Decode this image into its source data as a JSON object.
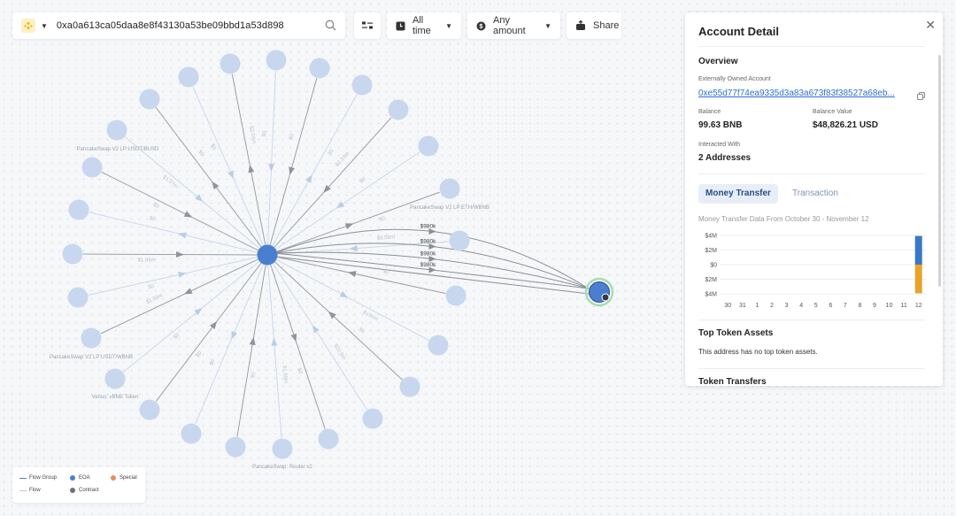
{
  "search": {
    "chain_icon": "bnb-chain-icon",
    "address": "0xa0a613ca05daa8e8f43130a53be09bbd1a53d898"
  },
  "toolbar": {
    "time_label": "All time",
    "amount_label": "Any amount",
    "share_label": "Share"
  },
  "graph": {
    "node_labels": {
      "lp_usdt_busd": "PancakeSwap V2 LP:USDT/BUSD",
      "lp_eth_wbnb": "PancakeSwap V2 LP:ETH/WBNB",
      "lp_usdt_wbnb": "PancakeSwap V2 LP:USDT/WBNB",
      "venus": "Venus: vBNB Token",
      "router": "PancakeSwap: Router v2"
    },
    "edge_labels": [
      "$980k",
      "$980k",
      "$980k",
      "$980k"
    ],
    "faint_edge_labels": [
      "$2.54m",
      "$0",
      "$0",
      "$0",
      "$2.33m",
      "$0",
      "$0",
      "$9.58m",
      "$0",
      "$136m",
      "$0",
      "$22.9m",
      "$0",
      "$1.60m",
      "$0",
      "$0",
      "$0",
      "$0",
      "$1.50m",
      "$0",
      "$1.06m",
      "$0",
      "$0",
      "$1.07m",
      "$0",
      "$0",
      "$0"
    ]
  },
  "legend": {
    "flow_group": "Flow Group",
    "eoa": "EOA",
    "special": "Special",
    "flow": "Flow",
    "contract": "Contract"
  },
  "panel": {
    "title": "Account Detail",
    "overview_heading": "Overview",
    "account_type": "Externally Owned Account",
    "account_address": "0xe55d77f74ea9335d3a83a673f83f38527a68eb...",
    "balance_label": "Balance",
    "balance_value": "99.63 BNB",
    "balance_value_label": "Balance Value",
    "balance_value_usd": "$48,826.21 USD",
    "interacted_label": "Interacted With",
    "interacted_value": "2 Addresses",
    "tab_money": "Money Transfer",
    "tab_tx": "Transaction",
    "chart_subtitle": "Money Transfer Data From October 30 - November 12",
    "top_token_heading": "Top Token Assets",
    "top_token_desc": "This address has no top token assets.",
    "token_transfers_heading": "Token Transfers"
  },
  "chart_data": {
    "type": "bar",
    "categories": [
      "30",
      "31",
      "1",
      "2",
      "3",
      "4",
      "5",
      "6",
      "7",
      "8",
      "9",
      "10",
      "11",
      "12"
    ],
    "y_tick_labels": [
      "$4M",
      "$2M",
      "$0",
      "$2M",
      "$4M"
    ],
    "y_ticks": [
      4,
      2,
      0,
      -2,
      -4
    ],
    "ylim": [
      -4,
      4
    ],
    "series": [
      {
        "values": [
          0,
          0,
          0,
          0,
          0,
          0,
          0,
          0,
          0,
          0,
          0,
          0,
          0,
          3.92
        ],
        "color": "#3b78c4"
      },
      {
        "values": [
          0,
          0,
          0,
          0,
          0,
          0,
          0,
          0,
          0,
          0,
          0,
          0,
          0,
          -3.92
        ],
        "color": "#e8a32c"
      }
    ]
  }
}
